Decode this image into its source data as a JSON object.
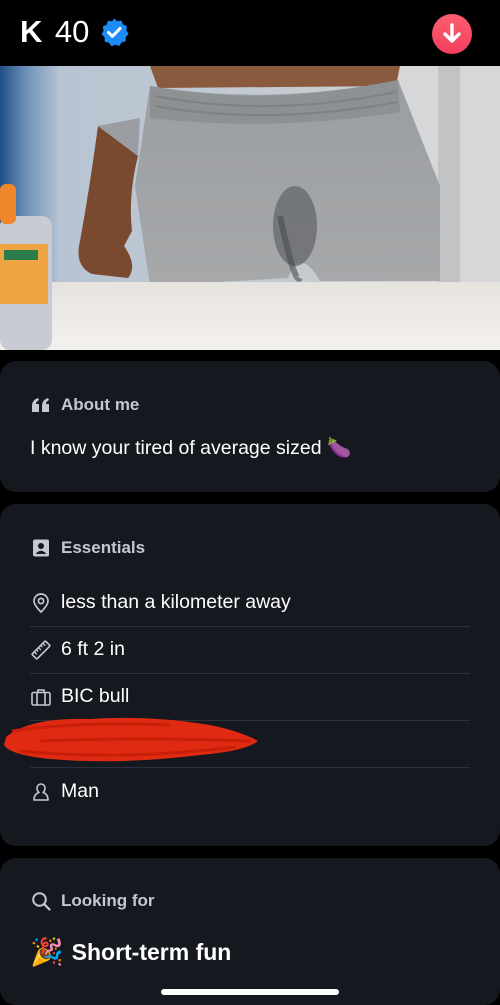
{
  "profile": {
    "initial": "K",
    "age": "40"
  },
  "about": {
    "header": "About me",
    "text": "I know your tired of average sized 🍆"
  },
  "essentials": {
    "header": "Essentials",
    "distance": "less than a kilometer away",
    "height": "6 ft 2 in",
    "job": "BIC bull",
    "gender": "Man"
  },
  "looking_for": {
    "header": "Looking for",
    "emoji": "🎉",
    "value": "Short-term fun"
  },
  "colors": {
    "background": "#000000",
    "card": "#15181e",
    "accent": "#fd5f6f",
    "verified": "#1d8cf8",
    "redaction": "#e02a12"
  }
}
